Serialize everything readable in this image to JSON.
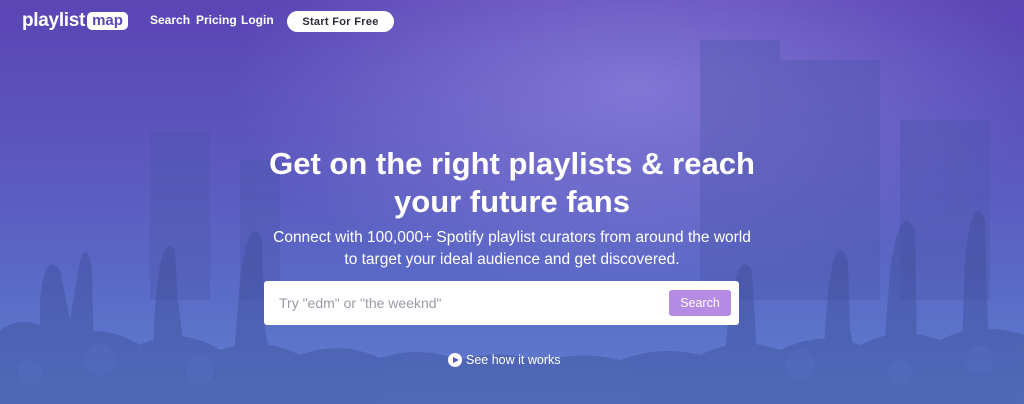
{
  "brand": {
    "logo_main": "playlist",
    "logo_accent": "map"
  },
  "nav": {
    "links": [
      {
        "label": "Search"
      },
      {
        "label": "Pricing"
      },
      {
        "label": "Login"
      }
    ],
    "cta_label": "Start For Free"
  },
  "hero": {
    "headline_line1": "Get on the right playlists & reach",
    "headline_line2": "your future fans",
    "subhead_line1": "Connect with 100,000+ Spotify playlist curators from around the world",
    "subhead_line2": "to target your ideal audience and get discovered."
  },
  "search": {
    "placeholder": "Try \"edm\" or \"the weeknd\"",
    "value": "",
    "button_label": "Search"
  },
  "video_link": {
    "label": "See how it works",
    "icon": "play-circle-icon"
  },
  "colors": {
    "gradient_top": "#5b45b4",
    "gradient_bottom": "#5f7fcf",
    "search_button": "#b58be3",
    "cta_background": "#ffffff"
  }
}
